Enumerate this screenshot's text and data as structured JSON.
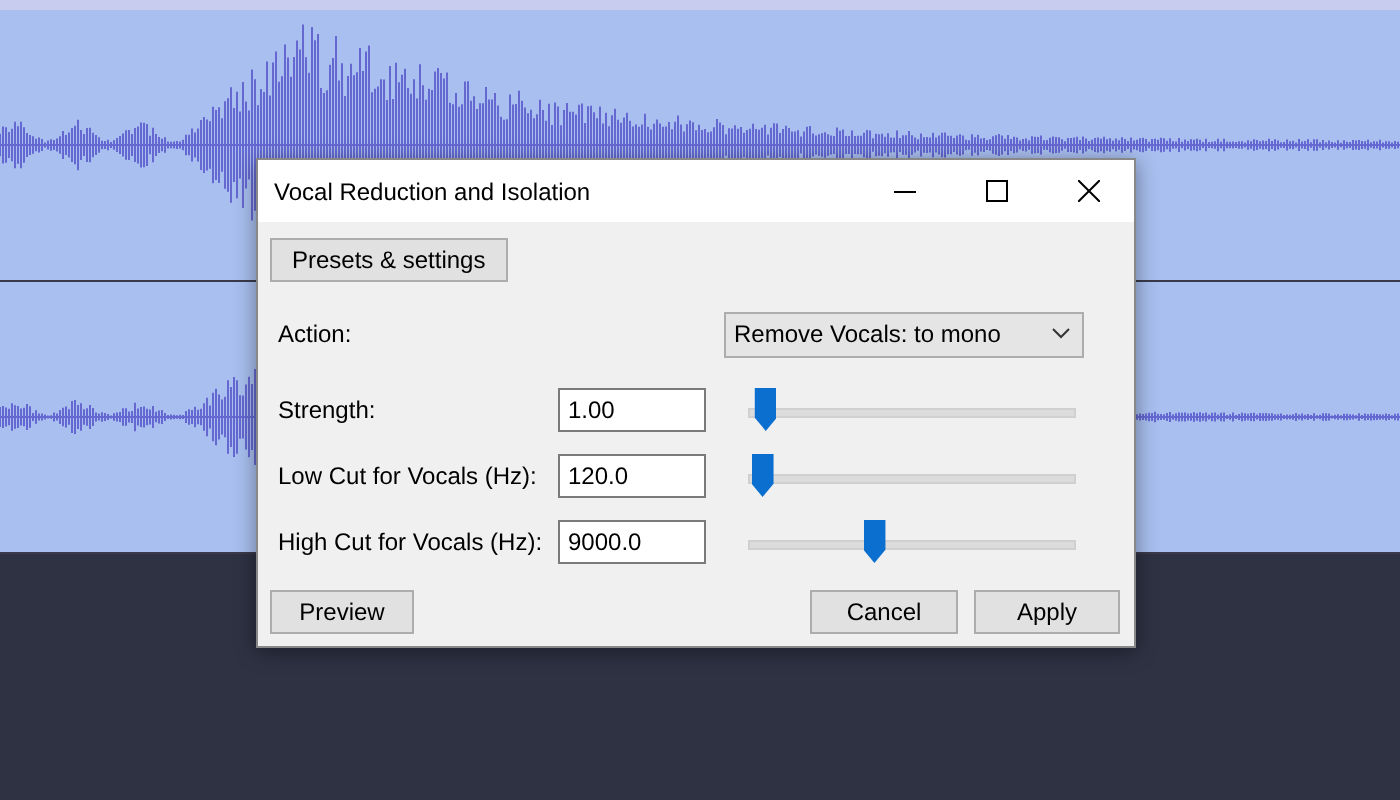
{
  "dialog": {
    "title": "Vocal Reduction and Isolation",
    "presets_button": "Presets & settings",
    "action": {
      "label": "Action:",
      "value": "Remove Vocals: to mono"
    },
    "parameters": [
      {
        "label": "Strength:",
        "value": "1.00",
        "level": 0.04
      },
      {
        "label": "Low Cut for Vocals (Hz):",
        "value": "120.0",
        "level": 0.03
      },
      {
        "label": "High Cut for Vocals (Hz):",
        "value": "9000.0",
        "level": 0.38
      }
    ],
    "buttons": {
      "preview": "Preview",
      "cancel": "Cancel",
      "apply": "Apply"
    }
  }
}
